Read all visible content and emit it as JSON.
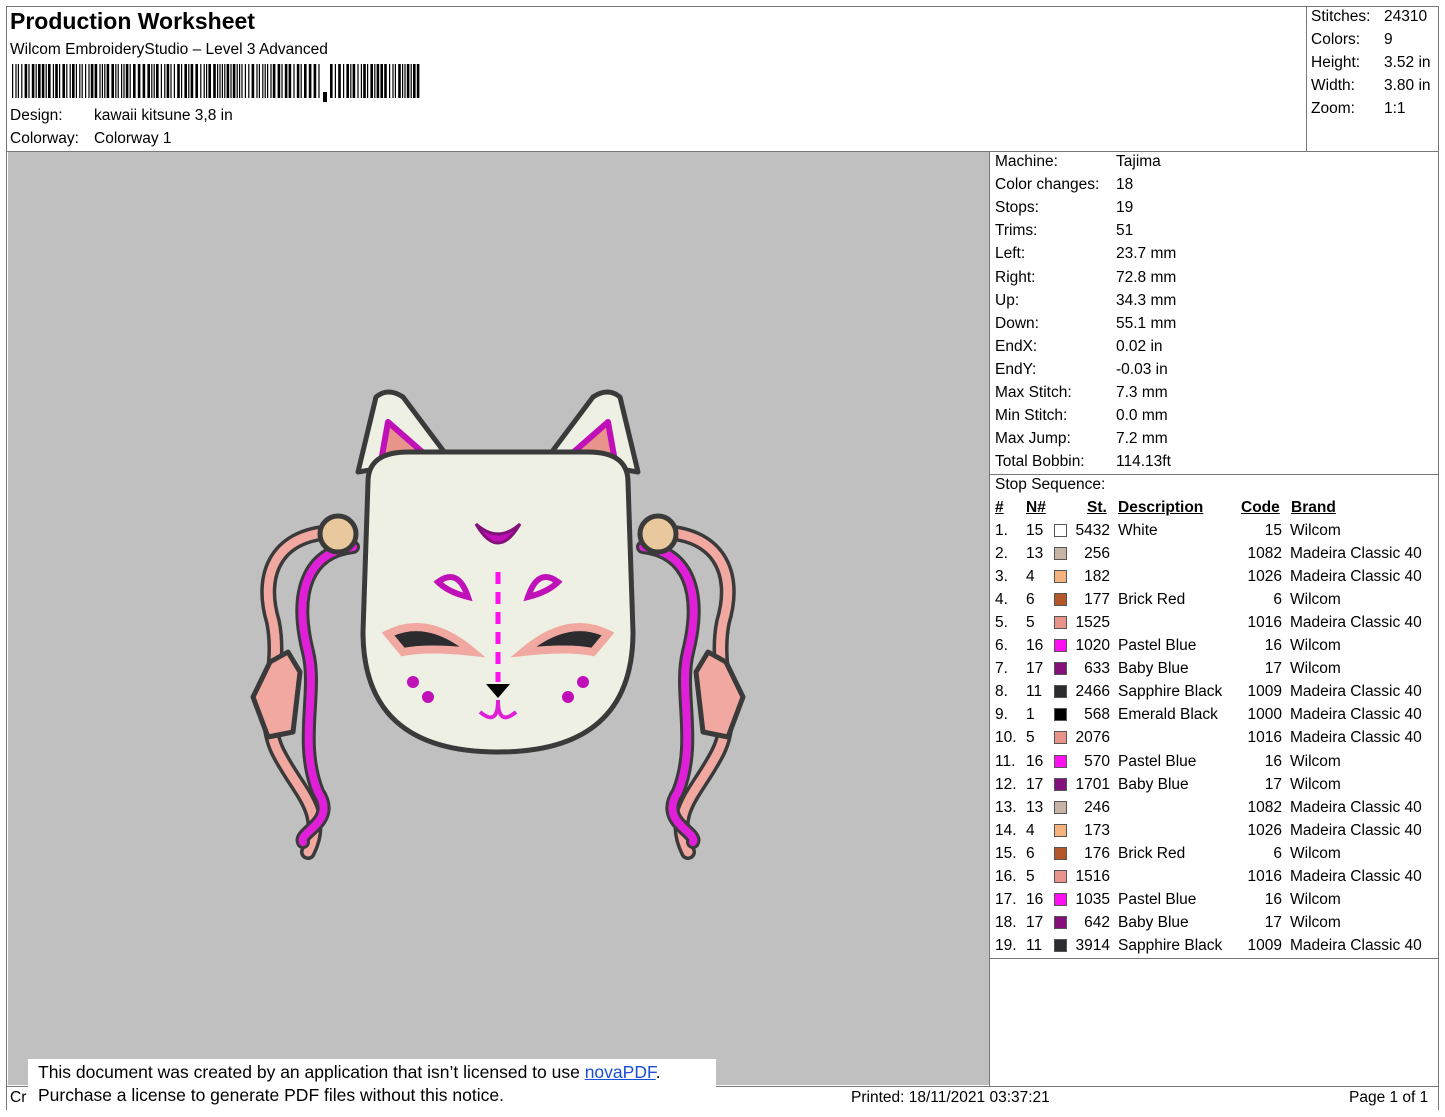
{
  "header": {
    "title": "Production Worksheet",
    "software": "Wilcom EmbroideryStudio – Level 3 Advanced",
    "design_label": "Design:",
    "design_value": "kawaii kitsune 3,8 in",
    "colorway_label": "Colorway:",
    "colorway_value": "Colorway 1"
  },
  "stats": [
    {
      "label": "Stitches:",
      "value": "24310"
    },
    {
      "label": "Colors:",
      "value": "9"
    },
    {
      "label": "Height:",
      "value": "3.52 in"
    },
    {
      "label": "Width:",
      "value": "3.80 in"
    },
    {
      "label": "Zoom:",
      "value": "1:1"
    }
  ],
  "details": [
    {
      "label": "Machine:",
      "value": "Tajima"
    },
    {
      "label": "Color changes:",
      "value": "18"
    },
    {
      "label": "Stops:",
      "value": "19"
    },
    {
      "label": "Trims:",
      "value": "51"
    },
    {
      "label": "Left:",
      "value": "23.7 mm"
    },
    {
      "label": "Right:",
      "value": "72.8 mm"
    },
    {
      "label": "Up:",
      "value": "34.3 mm"
    },
    {
      "label": "Down:",
      "value": "55.1 mm"
    },
    {
      "label": "EndX:",
      "value": "0.02 in"
    },
    {
      "label": "EndY:",
      "value": "-0.03 in"
    },
    {
      "label": "Max Stitch:",
      "value": "7.3 mm"
    },
    {
      "label": "Min Stitch:",
      "value": "0.0 mm"
    },
    {
      "label": "Max Jump:",
      "value": "7.2 mm"
    },
    {
      "label": "Total Bobbin:",
      "value": "114.13ft"
    }
  ],
  "stop_sequence": {
    "title": "Stop Sequence:",
    "headers": {
      "num": "#",
      "n": "N#",
      "st": "St.",
      "description": "Description",
      "code": "Code",
      "brand": "Brand"
    },
    "rows": [
      {
        "num": "1.",
        "n": "15",
        "color": "#ffffff",
        "st": "5432",
        "description": "White",
        "code": "15",
        "brand": "Wilcom"
      },
      {
        "num": "2.",
        "n": "13",
        "color": "#c8b4a4",
        "st": "256",
        "description": "",
        "code": "1082",
        "brand": "Madeira Classic 40"
      },
      {
        "num": "3.",
        "n": "4",
        "color": "#f4b27e",
        "st": "182",
        "description": "",
        "code": "1026",
        "brand": "Madeira Classic 40"
      },
      {
        "num": "4.",
        "n": "6",
        "color": "#b4582a",
        "st": "177",
        "description": "Brick Red",
        "code": "6",
        "brand": "Wilcom"
      },
      {
        "num": "5.",
        "n": "5",
        "color": "#e8948c",
        "st": "1525",
        "description": "",
        "code": "1016",
        "brand": "Madeira Classic 40"
      },
      {
        "num": "6.",
        "n": "16",
        "color": "#ff10f0",
        "st": "1020",
        "description": "Pastel Blue",
        "code": "16",
        "brand": "Wilcom"
      },
      {
        "num": "7.",
        "n": "17",
        "color": "#84107c",
        "st": "633",
        "description": "Baby Blue",
        "code": "17",
        "brand": "Wilcom"
      },
      {
        "num": "8.",
        "n": "11",
        "color": "#2c2c30",
        "st": "2466",
        "description": "Sapphire Black",
        "code": "1009",
        "brand": "Madeira Classic 40"
      },
      {
        "num": "9.",
        "n": "1",
        "color": "#000000",
        "st": "568",
        "description": "Emerald Black",
        "code": "1000",
        "brand": "Madeira Classic 40"
      },
      {
        "num": "10.",
        "n": "5",
        "color": "#e8948c",
        "st": "2076",
        "description": "",
        "code": "1016",
        "brand": "Madeira Classic 40"
      },
      {
        "num": "11.",
        "n": "16",
        "color": "#ff10f0",
        "st": "570",
        "description": "Pastel Blue",
        "code": "16",
        "brand": "Wilcom"
      },
      {
        "num": "12.",
        "n": "17",
        "color": "#84107c",
        "st": "1701",
        "description": "Baby Blue",
        "code": "17",
        "brand": "Wilcom"
      },
      {
        "num": "13.",
        "n": "13",
        "color": "#c8b4a4",
        "st": "246",
        "description": "",
        "code": "1082",
        "brand": "Madeira Classic 40"
      },
      {
        "num": "14.",
        "n": "4",
        "color": "#f4b27e",
        "st": "173",
        "description": "",
        "code": "1026",
        "brand": "Madeira Classic 40"
      },
      {
        "num": "15.",
        "n": "6",
        "color": "#b4582a",
        "st": "176",
        "description": "Brick Red",
        "code": "6",
        "brand": "Wilcom"
      },
      {
        "num": "16.",
        "n": "5",
        "color": "#e8948c",
        "st": "1516",
        "description": "",
        "code": "1016",
        "brand": "Madeira Classic 40"
      },
      {
        "num": "17.",
        "n": "16",
        "color": "#ff10f0",
        "st": "1035",
        "description": "Pastel Blue",
        "code": "16",
        "brand": "Wilcom"
      },
      {
        "num": "18.",
        "n": "17",
        "color": "#84107c",
        "st": "642",
        "description": "Baby Blue",
        "code": "17",
        "brand": "Wilcom"
      },
      {
        "num": "19.",
        "n": "11",
        "color": "#2c2c30",
        "st": "3914",
        "description": "Sapphire Black",
        "code": "1009",
        "brand": "Madeira Classic 40"
      }
    ]
  },
  "notice": {
    "line1_prefix": "This document was created by an application that isn’t licensed to use ",
    "link": "novaPDF",
    "line1_suffix": ".",
    "line2": "Purchase a license to generate PDF files without this notice."
  },
  "footer": {
    "left": "Cr",
    "printed": "Printed: 18/11/2021 03:37:21",
    "page": "Page 1 of 1"
  }
}
